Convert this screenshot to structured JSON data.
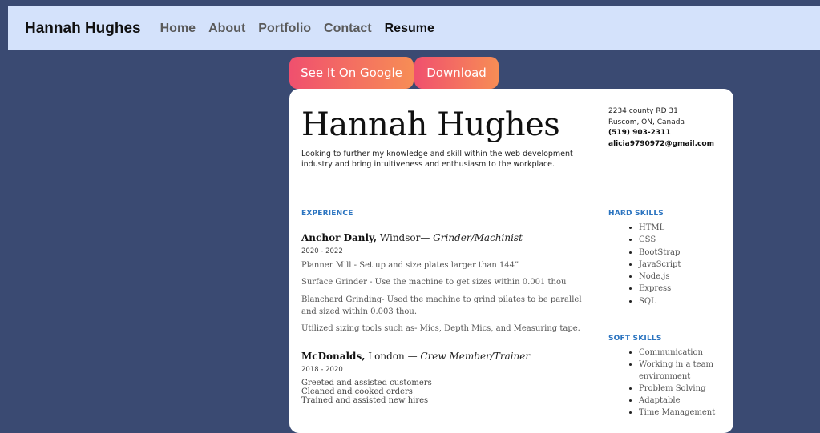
{
  "nav": {
    "brand": "Hannah Hughes",
    "links": [
      "Home",
      "About",
      "Portfolio",
      "Contact",
      "Resume"
    ]
  },
  "buttons": {
    "google": "See It On Google",
    "download": "Download"
  },
  "resume": {
    "name": "Hannah Hughes",
    "tagline": "Looking to further my knowledge and skill within the web development industry and bring intuitiveness and enthusiasm to the workplace.",
    "contact": {
      "address1": "2234 county RD 31",
      "address2": "Ruscom, ON, Canada",
      "phone": "(519) 903-2311",
      "email": "alicia9790972@gmail.com"
    },
    "experience_title": "EXPERIENCE",
    "jobs": [
      {
        "company": "Anchor Danly,",
        "location": " Windsor— ",
        "role": "Grinder/Machinist",
        "dates": "2020 - 2022",
        "duties": [
          "Planner Mill - Set up and size plates larger than 144”",
          "Surface Grinder - Use the machine to get sizes within 0.001 thou",
          "Blanchard Grinding- Used the machine to grind pilates to be parallel and sized within 0.003 thou.",
          "Utilized sizing tools such as- Mics, Depth Mics, and Measuring tape."
        ]
      },
      {
        "company": "McDonalds,",
        "location": " London — ",
        "role": "Crew Member/Trainer",
        "dates": "2018 - 2020",
        "duties": [
          "Greeted and assisted customers",
          "Cleaned and cooked orders",
          "Trained and assisted new hires"
        ]
      }
    ],
    "hard_skills_title": "HARD SKILLS",
    "hard_skills": [
      "HTML",
      "CSS",
      "BootStrap",
      "JavaScript",
      "Node.js",
      "Express",
      "SQL"
    ],
    "soft_skills_title": "SOFT SKILLS",
    "soft_skills": [
      "Communication",
      "Working in a team environment",
      "Problem Solving",
      "Adaptable",
      "Time Management"
    ]
  }
}
